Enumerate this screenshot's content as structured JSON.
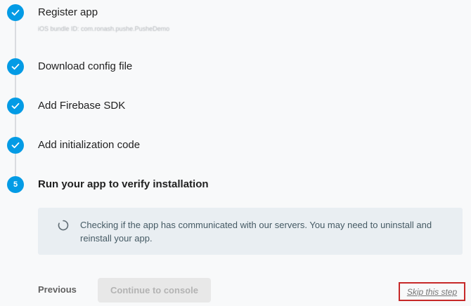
{
  "steps": [
    {
      "label": "Register app",
      "subtitle": "iOS bundle ID: com.ronash.pushe.PusheDemo",
      "state": "completed",
      "icon": "check-icon"
    },
    {
      "label": "Download config file",
      "state": "completed",
      "icon": "check-icon"
    },
    {
      "label": "Add Firebase SDK",
      "state": "completed",
      "icon": "check-icon"
    },
    {
      "label": "Add initialization code",
      "state": "completed",
      "icon": "check-icon"
    },
    {
      "label": "Run your app to verify installation",
      "state": "active",
      "number": "5"
    }
  ],
  "status": {
    "icon": "spinner-icon",
    "message": "Checking if the app has communicated with our servers. You may need to uninstall and reinstall your app."
  },
  "footer": {
    "previous_label": "Previous",
    "continue_label": "Continue to console",
    "skip_label": "Skip this step"
  },
  "colors": {
    "accent": "#039be5",
    "status_background": "#e9eef2",
    "highlight_border": "#c62828"
  }
}
